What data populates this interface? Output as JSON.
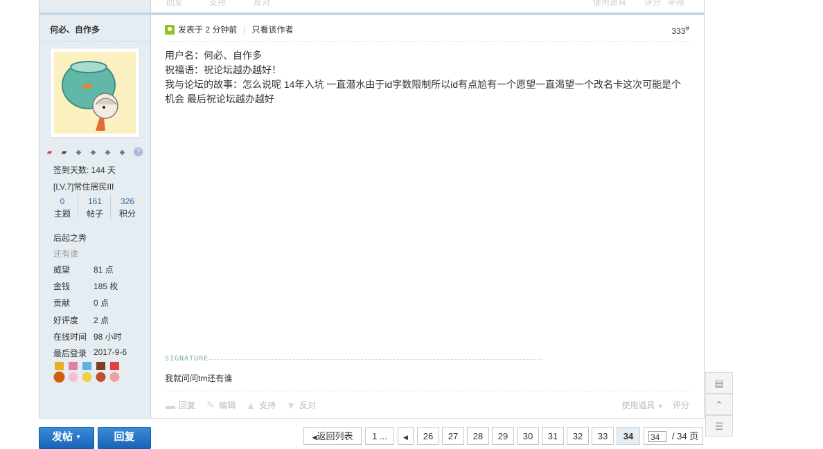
{
  "prev_post": {
    "actions": [
      "回复",
      "支持",
      "反对"
    ],
    "right_actions": [
      "使用道具",
      "评分",
      "举报"
    ]
  },
  "author": {
    "name": "何必、自作多",
    "checkin": "签到天数: 144 天",
    "level": "[LV.7]常住居民III",
    "stats": [
      {
        "value": "0",
        "label": "主题"
      },
      {
        "value": "161",
        "label": "帖子"
      },
      {
        "value": "326",
        "label": "积分"
      }
    ],
    "rank_title": "后起之秀",
    "custom_title": "还有谁",
    "fields": [
      {
        "key": "威望",
        "value": "81 点"
      },
      {
        "key": "金钱",
        "value": "185 枚"
      },
      {
        "key": "贡献",
        "value": "0 点"
      },
      {
        "key": "好评度",
        "value": "2 点"
      },
      {
        "key": "在线时间",
        "value": "98 小时"
      },
      {
        "key": "最后登录",
        "value": "2017-9-6"
      }
    ],
    "help_mark": "?"
  },
  "post": {
    "posted": "发表于 2 分钟前",
    "only_author": "只看该作者",
    "floor": "333",
    "floor_suffix": "#",
    "lines": [
      "用户名：何必、自作多",
      "祝福语：祝论坛越办越好！",
      "我与论坛的故事：怎么说呢 14年入坑 一直潜水由于id字数限制所以id有点尬有一个愿望一直渴望一个改名卡这次可能是个机会 最后祝论坛越办越好"
    ],
    "signature_label": "SIGNATURE",
    "signature": "我就问问tm还有谁",
    "actions": [
      "回复",
      "编辑",
      "支持",
      "反对"
    ],
    "right_actions": [
      "使用道具",
      "评分"
    ]
  },
  "bottom": {
    "new_post": "发帖",
    "reply": "回复",
    "back_list": "返回列表",
    "first_page": "1 ...",
    "pages": [
      "26",
      "27",
      "28",
      "29",
      "30",
      "31",
      "32",
      "33",
      "34"
    ],
    "current_page": "34",
    "page_input": "34",
    "total": "/ 34 页"
  }
}
